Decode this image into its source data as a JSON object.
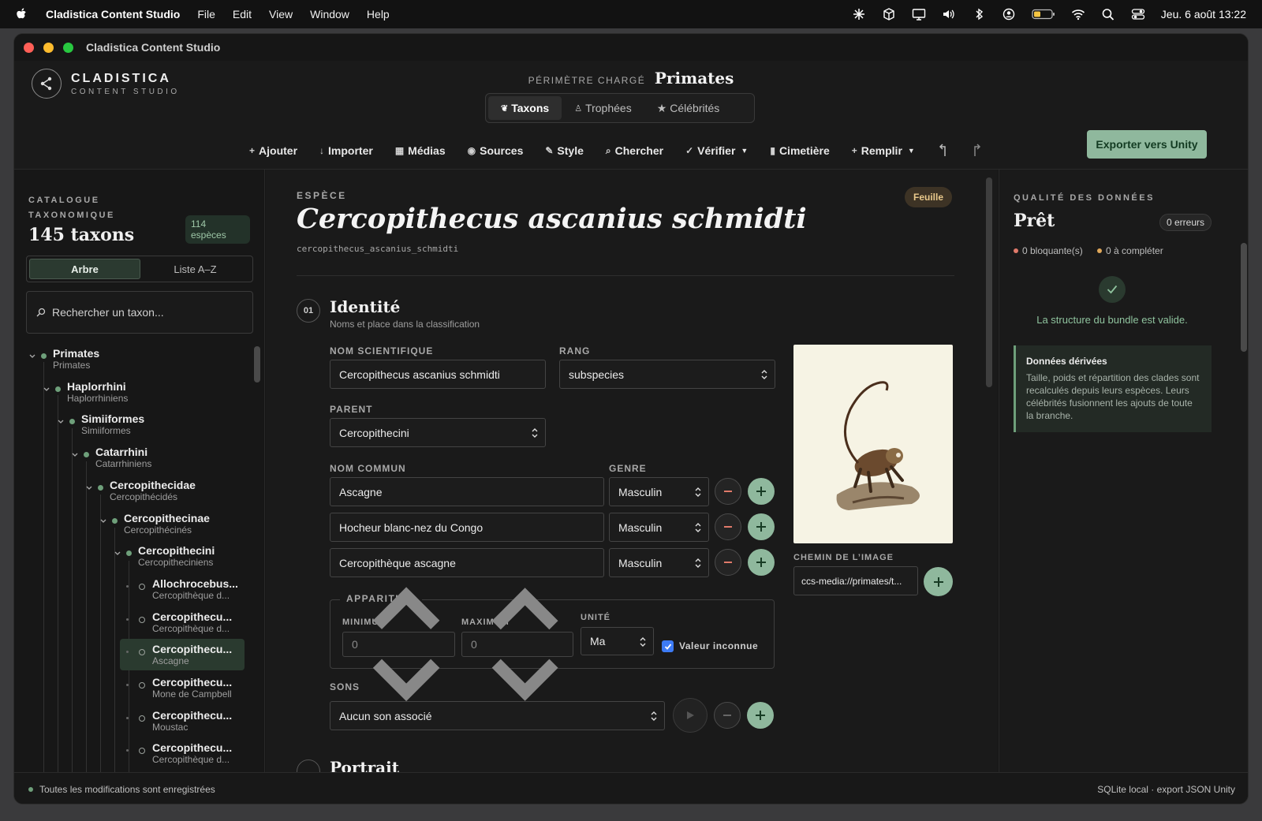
{
  "menubar": {
    "app_name": "Cladistica Content Studio",
    "menus": [
      "File",
      "Edit",
      "View",
      "Window",
      "Help"
    ],
    "datetime": "Jeu. 6 août  13:22"
  },
  "window": {
    "title": "Cladistica Content Studio"
  },
  "brand": {
    "line1": "CLADISTICA",
    "line2": "CONTENT STUDIO"
  },
  "scope": {
    "label": "PÉRIMÈTRE CHARGÉ",
    "value": "Primates"
  },
  "tabs": [
    {
      "icon": "❦",
      "label": "Taxons",
      "active": true
    },
    {
      "icon": "♙",
      "label": "Trophées"
    },
    {
      "icon": "★",
      "label": "Célébrités"
    }
  ],
  "toolbar": {
    "items": [
      {
        "glyph": "+",
        "label": "Ajouter"
      },
      {
        "glyph": "↓",
        "label": "Importer"
      },
      {
        "glyph": "▦",
        "label": "Médias"
      },
      {
        "glyph": "◉",
        "label": "Sources"
      },
      {
        "glyph": "✎",
        "label": "Style"
      },
      {
        "glyph": "⌕",
        "label": "Chercher"
      },
      {
        "glyph": "✓",
        "label": "Vérifier",
        "caret": true
      },
      {
        "glyph": "▮",
        "label": "Cimetière"
      },
      {
        "glyph": "+",
        "label": "Remplir",
        "caret": true
      }
    ],
    "export_label": "Exporter vers Unity"
  },
  "catalog": {
    "label_line1": "CATALOGUE",
    "label_line2": "TAXONOMIQUE",
    "count": "145 taxons",
    "species_count": "114",
    "species_label": "espèces",
    "view_tree": "Arbre",
    "view_list": "Liste A–Z",
    "search_placeholder": "Rechercher un taxon..."
  },
  "tree": [
    {
      "name": "Primates",
      "sub": "Primates"
    },
    {
      "name": "Haplorrhini",
      "sub": "Haplorrhiniens"
    },
    {
      "name": "Simiiformes",
      "sub": "Simiiformes"
    },
    {
      "name": "Catarrhini",
      "sub": "Catarrhiniens"
    },
    {
      "name": "Cercopithecidae",
      "sub": "Cercopithécidés"
    },
    {
      "name": "Cercopithecinae",
      "sub": "Cercopithécinés"
    },
    {
      "name": "Cercopithecini",
      "sub": "Cercopitheciniens"
    },
    {
      "name": "Allochrocebus...",
      "sub": "Cercopithèque d..."
    },
    {
      "name": "Cercopithecu...",
      "sub": "Cercopithèque d..."
    },
    {
      "name": "Cercopithecu...",
      "sub": "Ascagne",
      "selected": true
    },
    {
      "name": "Cercopithecu...",
      "sub": "Mone de Campbell"
    },
    {
      "name": "Cercopithecu...",
      "sub": "Moustac"
    },
    {
      "name": "Cercopithecu...",
      "sub": "Cercopithèque d..."
    }
  ],
  "species": {
    "kicker": "ESPÈCE",
    "badge": "Feuille",
    "title": "Cercopithecus ascanius schmidti",
    "slug": "cercopithecus_ascanius_schmidti"
  },
  "identity": {
    "num": "01",
    "title": "Identité",
    "subtitle": "Noms et place dans la classification",
    "sci_label": "NOM SCIENTIFIQUE",
    "sci_value": "Cercopithecus ascanius schmidti",
    "rank_label": "RANG",
    "rank_value": "subspecies",
    "parent_label": "PARENT",
    "parent_value": "Cercopithecini",
    "common_label": "NOM COMMUN",
    "gender_label": "GENRE",
    "common_names": [
      {
        "name": "Ascagne",
        "gender": "Masculin"
      },
      {
        "name": "Hocheur blanc-nez du Congo",
        "gender": "Masculin"
      },
      {
        "name": "Cercopithèque ascagne",
        "gender": "Masculin"
      }
    ],
    "image_path_label": "CHEMIN DE L’IMAGE",
    "image_path_value": "ccs-media://primates/t...",
    "apparition": {
      "legend": "APPARITION",
      "min_label": "MINIMUM",
      "min_value": "0",
      "max_label": "MAXIMUM",
      "max_value": "0",
      "unit_label": "UNITÉ",
      "unit_value": "Ma",
      "unknown_label": "Valeur inconnue",
      "unknown_checked": true
    },
    "sounds_label": "SONS",
    "sounds_value": "Aucun son associé"
  },
  "portrait": {
    "title": "Portrait"
  },
  "quality": {
    "label": "QUALITÉ DES DONNÉES",
    "state": "Prêt",
    "errors": "0 erreurs",
    "blocking": "0 bloquante(s)",
    "to_complete": "0 à compléter",
    "valid_msg": "La structure du bundle est valide.",
    "derived_title": "Données dérivées",
    "derived_body": "Taille, poids et répartition des clades sont recalculés depuis leurs espèces. Leurs célébrités fusionnent les ajouts de toute la branche."
  },
  "status": {
    "left": "Toutes les modifications sont enregistrées",
    "right": "SQLite local · export JSON Unity"
  },
  "colors": {
    "accent": "#8fb89d",
    "badge_bg": "#3d3325",
    "badge_fg": "#e9c98b",
    "error_dot": "#e07a6a",
    "warn_dot": "#e0a85a"
  }
}
